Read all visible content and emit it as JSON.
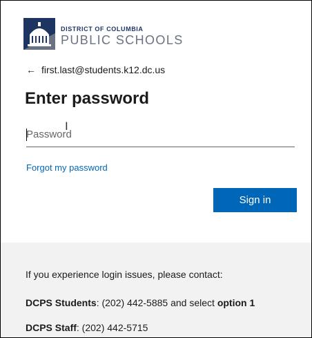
{
  "logo": {
    "line1": "DISTRICT OF COLUMBIA",
    "line2": "PUBLIC SCHOOLS",
    "icon": "capitol-dome-icon"
  },
  "identity": {
    "back_icon": "←",
    "email": "first.last@students.k12.dc.us"
  },
  "title": "Enter password",
  "password": {
    "placeholder": "Password",
    "value": ""
  },
  "forgot_link": "Forgot my password",
  "signin_label": "Sign in",
  "footer": {
    "contact_intro": "If you experience login issues, please contact:",
    "students_label": "DCPS Students",
    "students_text": ": (202) 442-5885 and select ",
    "students_option": "option 1",
    "staff_label": "DCPS Staff",
    "staff_text": ": (202) 442-5715"
  },
  "colors": {
    "accent": "#0067b8",
    "footer_bg": "#f2f2f2",
    "logo_navy": "#1e3461",
    "logo_gray": "#6a7381"
  }
}
